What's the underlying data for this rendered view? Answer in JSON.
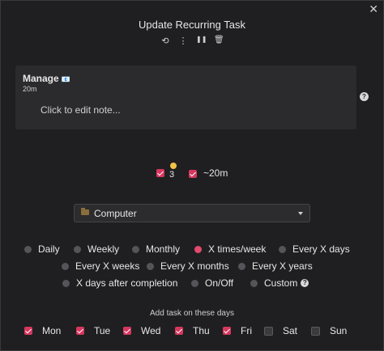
{
  "dialog": {
    "title": "Update Recurring Task",
    "close_icon": "close-icon"
  },
  "toolbar": {
    "icons": [
      "history-icon",
      "more-vertical-icon",
      "pause-icon",
      "trash-icon"
    ],
    "history_glyph": "⟲",
    "more_glyph": "⋮",
    "pause_glyph": "❚❚",
    "trash_glyph": "🗑"
  },
  "task": {
    "name": "Manage",
    "emoji": "📧",
    "duration": "20m",
    "note_placeholder": "Click to edit note..."
  },
  "priority": {
    "checked": true,
    "value": "3",
    "color": "#f0c14b"
  },
  "estimate": {
    "checked": true,
    "value": "~20m"
  },
  "project": {
    "value": "Computer"
  },
  "recurrence": {
    "options": [
      {
        "label": "Daily",
        "selected": false
      },
      {
        "label": "Weekly",
        "selected": false
      },
      {
        "label": "Monthly",
        "selected": false
      },
      {
        "label": "X times/week",
        "selected": true
      },
      {
        "label": "Every X days",
        "selected": false
      },
      {
        "label": "Every X weeks",
        "selected": false
      },
      {
        "label": "Every X months",
        "selected": false
      },
      {
        "label": "Every X years",
        "selected": false
      },
      {
        "label": "X days after completion",
        "selected": false
      },
      {
        "label": "On/Off",
        "selected": false
      },
      {
        "label": "Custom",
        "selected": false
      }
    ]
  },
  "days": {
    "label": "Add task on these days",
    "items": [
      {
        "label": "Mon",
        "checked": true
      },
      {
        "label": "Tue",
        "checked": true
      },
      {
        "label": "Wed",
        "checked": true
      },
      {
        "label": "Thu",
        "checked": true
      },
      {
        "label": "Fri",
        "checked": true
      },
      {
        "label": "Sat",
        "checked": false
      },
      {
        "label": "Sun",
        "checked": false
      }
    ]
  },
  "colors": {
    "accent": "#d6375e",
    "background": "#1f1f21",
    "card": "#2b2b2e"
  }
}
